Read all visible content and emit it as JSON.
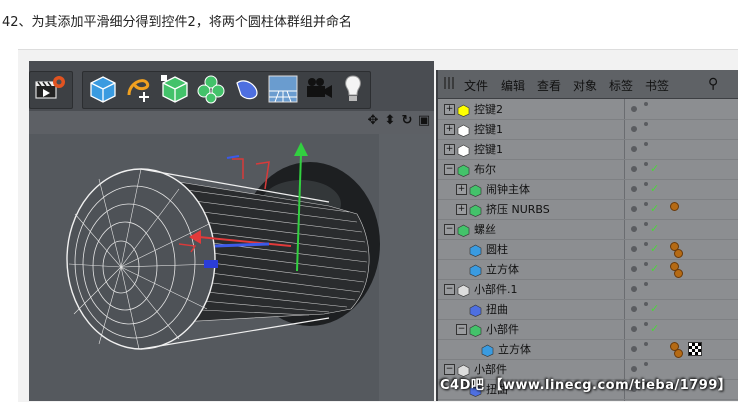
{
  "caption": "42、为其添加平滑细分得到控件2，将两个圆柱体群组并命名",
  "toolbar": {
    "icons": [
      "film-settings-icon",
      "cube-icon",
      "spline-pen-icon",
      "subdivision-icon",
      "cloner-icon",
      "deformer-icon",
      "floor-icon",
      "camera-icon",
      "light-icon"
    ]
  },
  "viewport": {
    "nav_icons": [
      "move-view-icon",
      "pan-view-icon",
      "rotate-view-icon",
      "maximize-view-icon"
    ]
  },
  "object_manager": {
    "menu": [
      "文件",
      "编辑",
      "查看",
      "对象",
      "标签",
      "书签"
    ],
    "rows": [
      {
        "label": "控键2",
        "indent": 0,
        "expand": "+",
        "check": false
      },
      {
        "label": "控键1",
        "indent": 0,
        "expand": "+",
        "check": false
      },
      {
        "label": "控键1",
        "indent": 0,
        "expand": "+",
        "check": false
      },
      {
        "label": "布尔",
        "indent": 0,
        "expand": "-",
        "check": true
      },
      {
        "label": "闹钟主体",
        "indent": 1,
        "expand": "+",
        "check": true
      },
      {
        "label": "挤压 NURBS",
        "indent": 1,
        "expand": "+",
        "check": true
      },
      {
        "label": "螺丝",
        "indent": 0,
        "expand": "-",
        "check": true
      },
      {
        "label": "圆柱",
        "indent": 1,
        "expand": "",
        "check": true
      },
      {
        "label": "立方体",
        "indent": 1,
        "expand": "",
        "check": true
      },
      {
        "label": "小部件.1",
        "indent": 0,
        "expand": "-",
        "check": false
      },
      {
        "label": "扭曲",
        "indent": 1,
        "expand": "",
        "check": true
      },
      {
        "label": "小部件",
        "indent": 1,
        "expand": "-",
        "check": true
      },
      {
        "label": "立方体",
        "indent": 2,
        "expand": "",
        "check": false
      },
      {
        "label": "小部件",
        "indent": 0,
        "expand": "-",
        "check": false
      },
      {
        "label": "扭曲",
        "indent": 1,
        "expand": "",
        "check": false
      }
    ]
  },
  "watermark": "C4D吧 【www.linecg.com/tieba/1799】",
  "colors": {
    "toolbar": "#4a4d52",
    "viewport": "#55595e",
    "object_manager": "#8c8e91",
    "check": "#4ed43d",
    "tag": "#b56a14"
  }
}
